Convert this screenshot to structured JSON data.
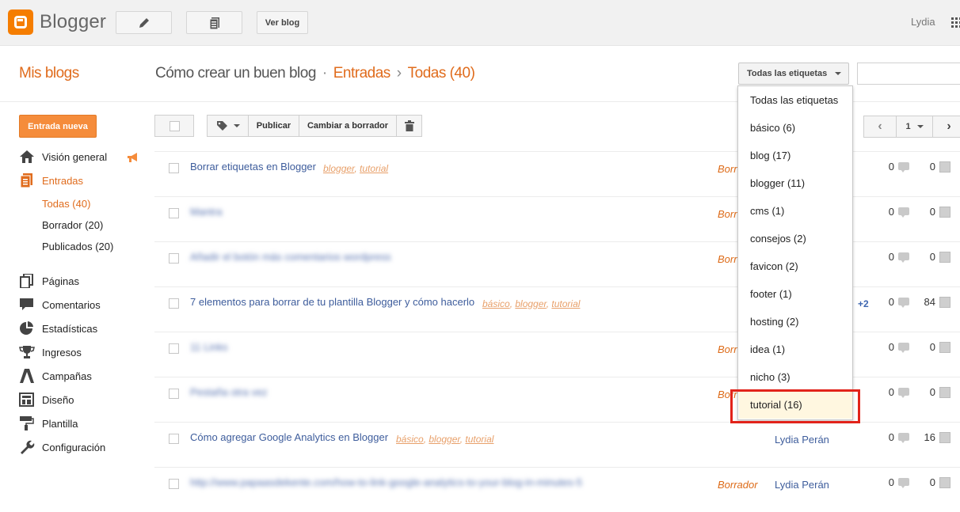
{
  "header": {
    "app_name": "Blogger",
    "view_blog_label": "Ver blog",
    "user_name": "Lydia"
  },
  "breadcrumb": {
    "my_blogs": "Mis blogs",
    "blog_name": "Cómo crear un buen blog",
    "dot": "·",
    "section": "Entradas",
    "arrow": "›",
    "current": "Todas (40)"
  },
  "filters": {
    "label_filter": "Todas las etiquetas"
  },
  "sidebar": {
    "new_post_label": "Entrada nueva",
    "items": [
      {
        "label": "Visión general",
        "icon": "home-icon"
      },
      {
        "label": "Entradas",
        "icon": "posts-icon"
      },
      {
        "label": "Páginas",
        "icon": "pages-icon"
      },
      {
        "label": "Comentarios",
        "icon": "comments-icon"
      },
      {
        "label": "Estadísticas",
        "icon": "stats-icon"
      },
      {
        "label": "Ingresos",
        "icon": "trophy-icon"
      },
      {
        "label": "Campañas",
        "icon": "campaign-icon"
      },
      {
        "label": "Diseño",
        "icon": "layout-icon"
      },
      {
        "label": "Plantilla",
        "icon": "paint-roller-icon"
      },
      {
        "label": "Configuración",
        "icon": "wrench-icon"
      }
    ],
    "sub_items": [
      "Todas (40)",
      "Borrador (20)",
      "Publicados (20)"
    ]
  },
  "toolbar": {
    "publish_label": "Publicar",
    "draft_label": "Cambiar a borrador"
  },
  "pager": {
    "page": "1"
  },
  "posts": [
    {
      "title": "Borrar etiquetas en Blogger",
      "labels": [
        "blogger",
        "tutorial"
      ],
      "status": "Borr",
      "author": "",
      "extra": "",
      "comments": "0",
      "views": "0",
      "blurred": false
    },
    {
      "title": "Mantra",
      "labels": [],
      "status": "Borr",
      "author": "",
      "extra": "",
      "comments": "0",
      "views": "0",
      "blurred": true
    },
    {
      "title": "Añadir el botón más comentarios wordpress",
      "labels": [],
      "status": "Borr",
      "author": "",
      "extra": "",
      "comments": "0",
      "views": "0",
      "blurred": true
    },
    {
      "title": "7 elementos para borrar de tu plantilla Blogger y cómo hacerlo",
      "labels": [
        "básico",
        "blogger",
        "tutorial"
      ],
      "status": "",
      "author": "",
      "extra": "+2",
      "comments": "0",
      "views": "84",
      "blurred": false
    },
    {
      "title": "11 Links",
      "labels": [],
      "status": "Borr",
      "author": "",
      "extra": "",
      "comments": "0",
      "views": "0",
      "blurred": true
    },
    {
      "title": "Pestaña otra vez",
      "labels": [],
      "status": "Borr",
      "author": "",
      "extra": "",
      "comments": "0",
      "views": "0",
      "blurred": true
    },
    {
      "title": "Cómo agregar Google Analytics en Blogger",
      "labels": [
        "básico",
        "blogger",
        "tutorial"
      ],
      "status": "",
      "author": "Lydia Perán",
      "extra": "",
      "comments": "0",
      "views": "16",
      "blurred": false
    },
    {
      "title": "http://www.papaasdekente.com/how-to-link-google-analytics-to-your-blog-in-minutes-5",
      "labels": [],
      "status": "Borrador",
      "author": "Lydia Perán",
      "extra": "",
      "comments": "0",
      "views": "0",
      "blurred": true
    }
  ],
  "label_dropdown": {
    "options": [
      "Todas las etiquetas",
      "básico (6)",
      "blog (17)",
      "blogger (11)",
      "cms (1)",
      "consejos (2)",
      "favicon (2)",
      "footer (1)",
      "hosting (2)",
      "idea (1)",
      "nicho (3)",
      "tutorial (16)"
    ],
    "highlighted": "tutorial (16)",
    "highlight_color": "#e2231a"
  },
  "colors": {
    "brand": "#f57d00",
    "accent": "#e06c1d",
    "link": "#3e5d9c"
  }
}
